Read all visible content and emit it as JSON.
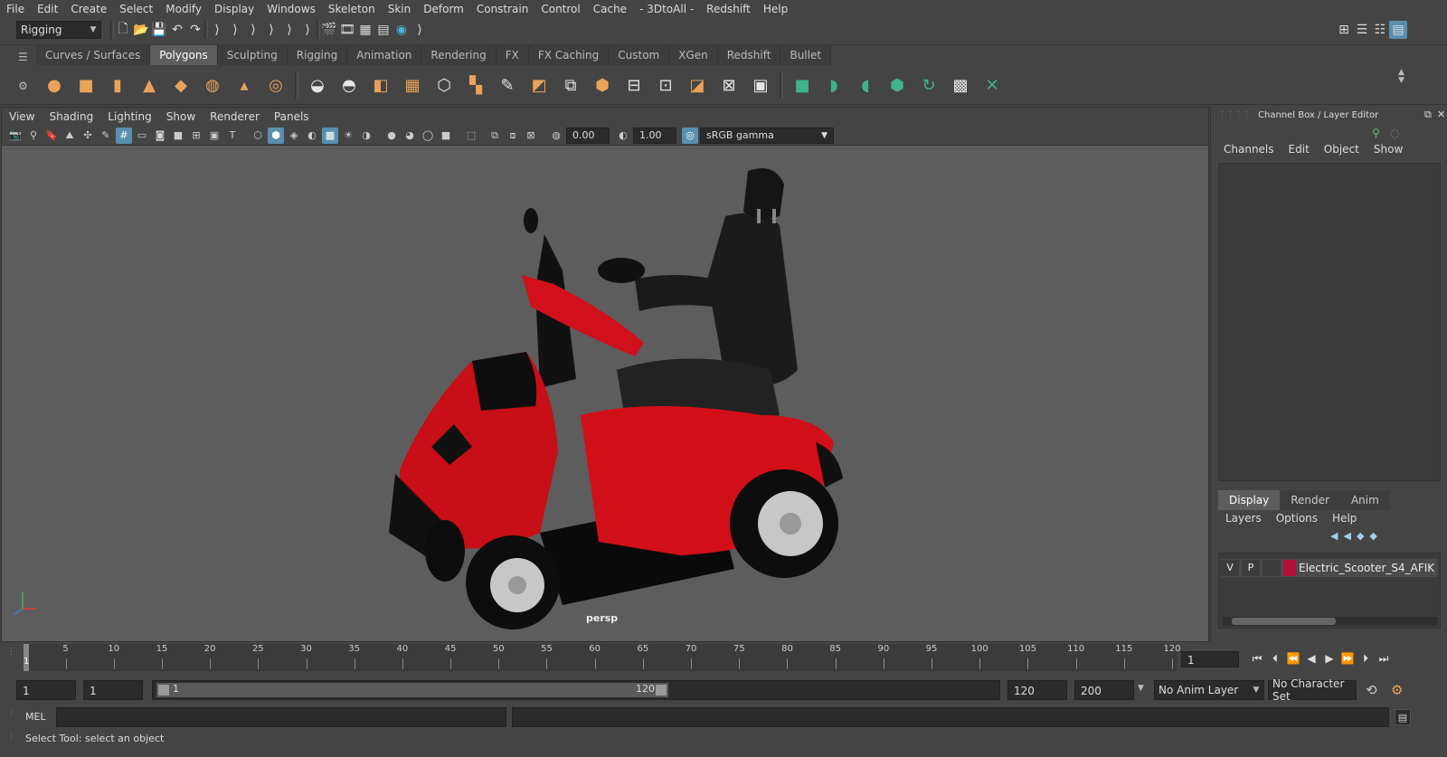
{
  "menu": [
    "File",
    "Edit",
    "Create",
    "Select",
    "Modify",
    "Display",
    "Windows",
    "Skeleton",
    "Skin",
    "Deform",
    "Constrain",
    "Control",
    "Cache",
    "- 3DtoAll -",
    "Redshift",
    "Help"
  ],
  "statusline": {
    "menuset": "Rigging"
  },
  "shelf": {
    "tabs": [
      "Curves / Surfaces",
      "Polygons",
      "Sculpting",
      "Rigging",
      "Animation",
      "Rendering",
      "FX",
      "FX Caching",
      "Custom",
      "XGen",
      "Redshift",
      "Bullet"
    ],
    "active_tab": "Polygons"
  },
  "viewport": {
    "menu": [
      "View",
      "Shading",
      "Lighting",
      "Show",
      "Renderer",
      "Panels"
    ],
    "exposure": "0.00",
    "gamma": "1.00",
    "colorspace": "sRGB gamma",
    "camera_label": "persp"
  },
  "channelbox": {
    "title": "Channel Box / Layer Editor",
    "tabs": [
      "Channels",
      "Edit",
      "Object",
      "Show"
    ]
  },
  "layereditor": {
    "tabs": [
      "Display",
      "Render",
      "Anim"
    ],
    "active_tab": "Display",
    "menu": [
      "Layers",
      "Options",
      "Help"
    ],
    "layers": [
      {
        "visible": "V",
        "playback": "P",
        "color": "#b0103a",
        "name": "Electric_Scooter_S4_AFIK"
      }
    ]
  },
  "timeslider": {
    "ticks": [
      5,
      10,
      15,
      20,
      25,
      30,
      35,
      40,
      45,
      50,
      55,
      60,
      65,
      70,
      75,
      80,
      85,
      90,
      95,
      100,
      105,
      110,
      115,
      120
    ],
    "current_marker": "1",
    "current_frame": "1"
  },
  "range": {
    "start": "1",
    "playback_start": "1",
    "slider_start": "1",
    "slider_end": "120",
    "playback_end": "120",
    "end": "200",
    "anim_layer": "No Anim Layer",
    "character_set": "No Character Set"
  },
  "commandline": {
    "label": "MEL"
  },
  "helpline": {
    "text": "Select Tool: select an object"
  },
  "colors": {
    "accent": "#5a8fb0",
    "scooter_red": "#d0101a",
    "shelf_orange": "#e9a25a",
    "shelf_green": "#3fb38a"
  }
}
